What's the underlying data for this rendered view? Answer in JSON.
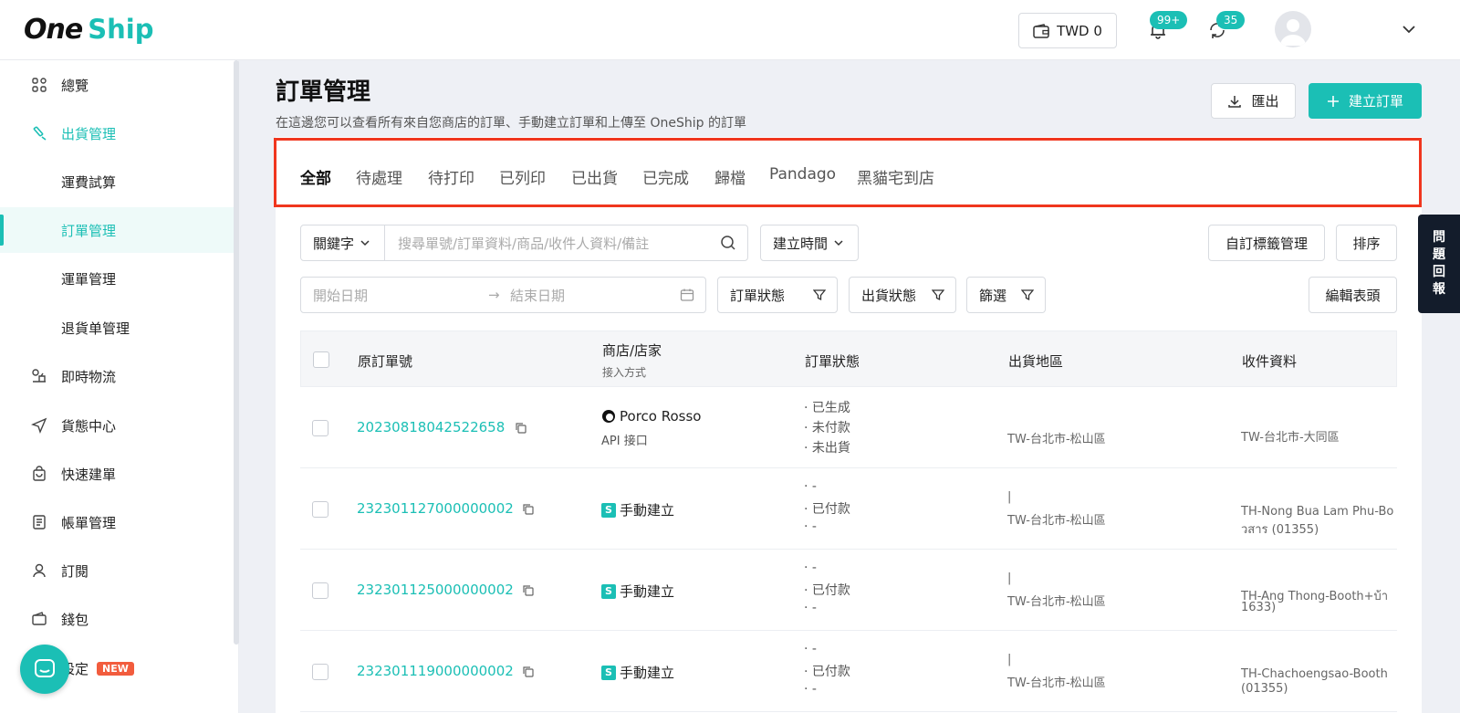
{
  "brand": {
    "logo_left": "One",
    "logo_right": "Ship",
    "accent": "#1bbfb5"
  },
  "header": {
    "wallet": "TWD  0",
    "notification_badge": "99+",
    "sync_badge": "35"
  },
  "sidebar": {
    "items": [
      {
        "label": "總覽",
        "icon": "grid-icon"
      },
      {
        "label": "出貨管理",
        "icon": "shipping-icon"
      },
      {
        "label": "運費試算"
      },
      {
        "label": "訂單管理"
      },
      {
        "label": "運單管理"
      },
      {
        "label": "退貨单管理"
      },
      {
        "label": "即時物流",
        "icon": "realtime-icon"
      },
      {
        "label": "貨態中心",
        "icon": "send-icon"
      },
      {
        "label": "快速建單",
        "icon": "bag-icon"
      },
      {
        "label": "帳單管理",
        "icon": "bill-icon"
      },
      {
        "label": "訂閱",
        "icon": "user-icon"
      },
      {
        "label": "錢包",
        "icon": "wallet-icon"
      },
      {
        "label": "設定",
        "icon": "settings-icon",
        "badge": "NEW"
      }
    ]
  },
  "page": {
    "title": "訂單管理",
    "description": "在這邊您可以查看所有來自您商店的訂單、手動建立訂單和上傳至 OneShip 的訂單",
    "export_label": "匯出",
    "create_label": "建立訂單"
  },
  "tabs": [
    "全部",
    "待處理",
    "待打印",
    "已列印",
    "已出貨",
    "已完成",
    "歸檔",
    "Pandago",
    "黑貓宅到店"
  ],
  "filters": {
    "keyword_select": "關鍵字",
    "search_placeholder": "搜尋單號/訂單資料/商品/收件人資料/備註",
    "time_select": "建立時間",
    "custom_tags": "自訂標籤管理",
    "sort": "排序",
    "start_placeholder": "開始日期",
    "end_placeholder": "結束日期",
    "order_status": "訂單狀態",
    "shipping_status": "出貨狀態",
    "filter": "篩選",
    "edit_header": "編輯表頭"
  },
  "table": {
    "headers": {
      "order_no": "原訂單號",
      "shop": "商店/店家",
      "shop_sub": "接入方式",
      "status": "訂單狀態",
      "region": "出貨地區",
      "receiver": "收件資料"
    },
    "rows": [
      {
        "order_no": "20230818042522658",
        "shop": "Porco Rosso",
        "shop_sub": "API 接口",
        "status": [
          "· 已生成",
          "· 未付款",
          "· 未出貨"
        ],
        "region_top": "",
        "region": "TW-台北市-松山區",
        "receiver_1": "TW-台北市-大同區",
        "receiver_2": ""
      },
      {
        "order_no": "232301127000000002",
        "shop": "手動建立",
        "shop_sub": "",
        "status": [
          "· -",
          "· 已付款",
          "· -"
        ],
        "region_top": "|",
        "region": "TW-台北市-松山區",
        "receiver_1": "TH-Nong Bua Lam Phu-Bo",
        "receiver_2": "วสาร (01355)"
      },
      {
        "order_no": "232301125000000002",
        "shop": "手動建立",
        "shop_sub": "",
        "status": [
          "· -",
          "· 已付款",
          "· -"
        ],
        "region_top": "|",
        "region": "TW-台北市-松山區",
        "receiver_1": "TH-Ang Thong-Booth+บ้า",
        "receiver_2": "1633)"
      },
      {
        "order_no": "232301119000000002",
        "shop": "手動建立",
        "shop_sub": "",
        "status": [
          "· -",
          "· 已付款",
          "· -"
        ],
        "region_top": "|",
        "region": "TW-台北市-松山區",
        "receiver_1": "TH-Chachoengsao-Booth",
        "receiver_2": "(01355)"
      }
    ]
  },
  "feedback": [
    "問",
    "題",
    "回",
    "報"
  ]
}
